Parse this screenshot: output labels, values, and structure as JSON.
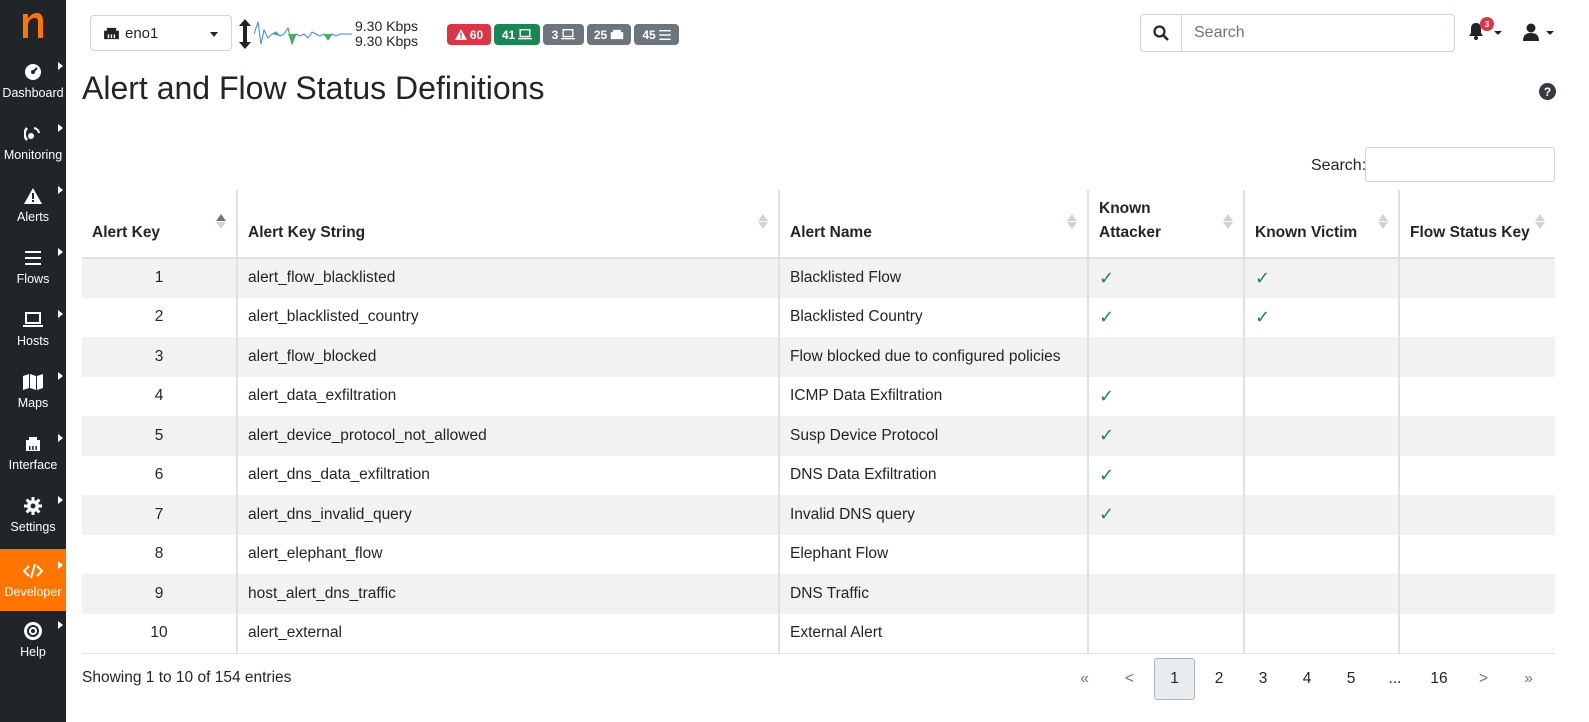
{
  "app": {
    "brand_color": "#ff7500",
    "sidebar_bg": "#212529"
  },
  "sidebar": {
    "items": [
      {
        "label": "Dashboard",
        "icon": "dashboard-icon"
      },
      {
        "label": "Monitoring",
        "icon": "monitoring-icon"
      },
      {
        "label": "Alerts",
        "icon": "warning-icon"
      },
      {
        "label": "Flows",
        "icon": "bars-icon"
      },
      {
        "label": "Hosts",
        "icon": "laptop-icon"
      },
      {
        "label": "Maps",
        "icon": "map-icon"
      },
      {
        "label": "Interface",
        "icon": "ethernet-icon"
      },
      {
        "label": "Settings",
        "icon": "gear-icon"
      },
      {
        "label": "Developer",
        "icon": "code-icon",
        "active": true
      },
      {
        "label": "Help",
        "icon": "lifebuoy-icon"
      }
    ]
  },
  "topbar": {
    "interface": "eno1",
    "speed_upload": "9.30 Kbps",
    "speed_download": "9.30 Kbps",
    "badges": {
      "alerts": "60",
      "active_hosts": "41",
      "hosts": "3",
      "devices": "25",
      "flows": "45"
    },
    "search_placeholder": "Search",
    "notifications_count": "3"
  },
  "page": {
    "title": "Alert and Flow Status Definitions",
    "table_search_label": "Search:"
  },
  "table": {
    "headers": {
      "alert_key": "Alert Key",
      "alert_key_string": "Alert Key String",
      "alert_name": "Alert Name",
      "known_attacker_1": "Known",
      "known_attacker_2": "Attacker",
      "known_victim": "Known Victim",
      "flow_status_key": "Flow Status Key"
    },
    "check_glyph": "✓",
    "rows": [
      {
        "key": "1",
        "key_string": "alert_flow_blacklisted",
        "name": "Blacklisted Flow",
        "attacker": true,
        "victim": true
      },
      {
        "key": "2",
        "key_string": "alert_blacklisted_country",
        "name": "Blacklisted Country",
        "attacker": true,
        "victim": true
      },
      {
        "key": "3",
        "key_string": "alert_flow_blocked",
        "name": "Flow blocked due to configured policies",
        "attacker": false,
        "victim": false
      },
      {
        "key": "4",
        "key_string": "alert_data_exfiltration",
        "name": "ICMP Data Exfiltration",
        "attacker": true,
        "victim": false
      },
      {
        "key": "5",
        "key_string": "alert_device_protocol_not_allowed",
        "name": "Susp Device Protocol",
        "attacker": true,
        "victim": false
      },
      {
        "key": "6",
        "key_string": "alert_dns_data_exfiltration",
        "name": "DNS Data Exfiltration",
        "attacker": true,
        "victim": false
      },
      {
        "key": "7",
        "key_string": "alert_dns_invalid_query",
        "name": "Invalid DNS query",
        "attacker": true,
        "victim": false
      },
      {
        "key": "8",
        "key_string": "alert_elephant_flow",
        "name": "Elephant Flow",
        "attacker": false,
        "victim": false
      },
      {
        "key": "9",
        "key_string": "host_alert_dns_traffic",
        "name": "DNS Traffic",
        "attacker": false,
        "victim": false
      },
      {
        "key": "10",
        "key_string": "alert_external",
        "name": "External Alert",
        "attacker": false,
        "victim": false
      }
    ]
  },
  "footer": {
    "info": "Showing 1 to 10 of 154 entries",
    "pagination": {
      "first": "«",
      "prev": "<",
      "pages": [
        "1",
        "2",
        "3",
        "4",
        "5"
      ],
      "ellipsis": "...",
      "last_page": "16",
      "next": ">",
      "last": "»",
      "current": "1"
    }
  }
}
